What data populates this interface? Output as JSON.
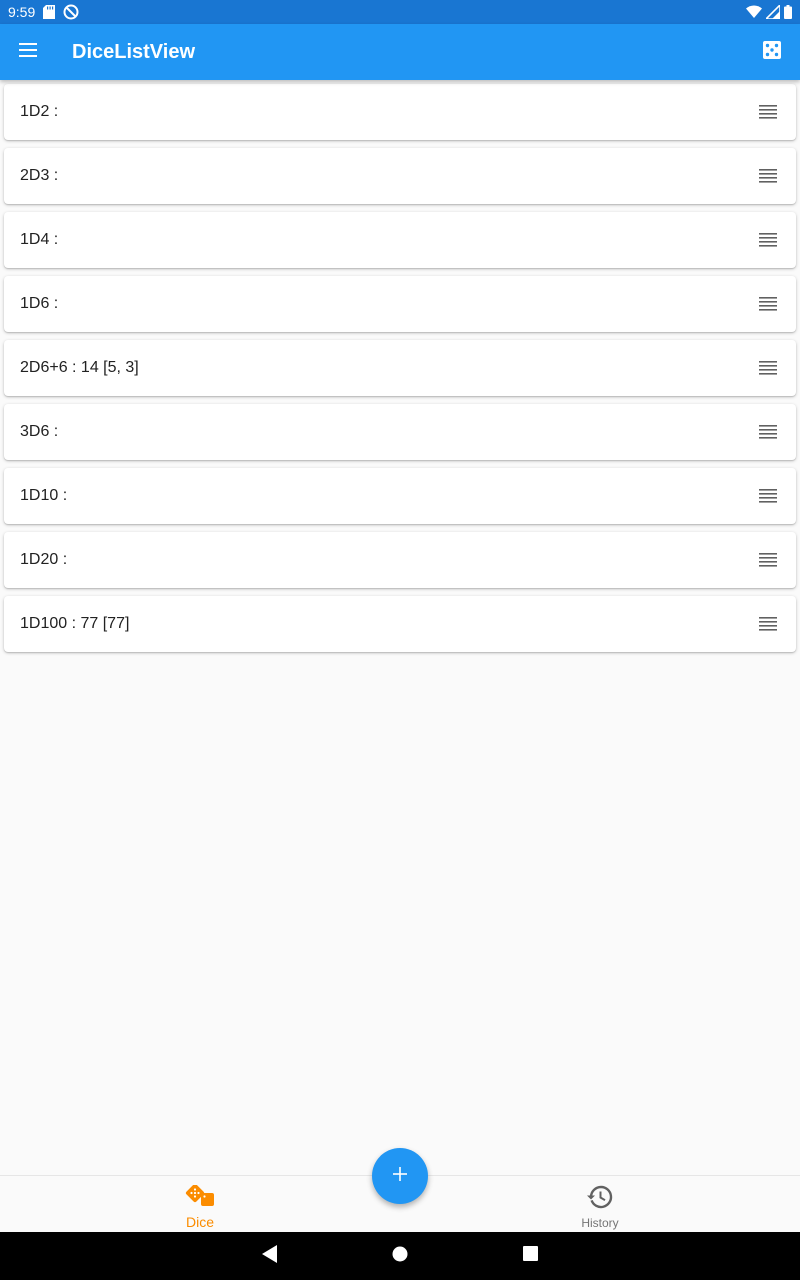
{
  "status_bar": {
    "time": "9:59"
  },
  "app_bar": {
    "title": "DiceListView",
    "menu_icon": "hamburger-menu-icon",
    "action_icon": "dice-icon"
  },
  "dice_list": [
    {
      "label": "1D2 :"
    },
    {
      "label": "2D3 :"
    },
    {
      "label": "1D4 :"
    },
    {
      "label": "1D6 :"
    },
    {
      "label": "2D6+6 : 14 [5, 3]"
    },
    {
      "label": "3D6 :"
    },
    {
      "label": "1D10 :"
    },
    {
      "label": "1D20 :"
    },
    {
      "label": "1D100 : 77 [77]"
    }
  ],
  "fab": {
    "icon": "plus-icon"
  },
  "bottom_nav": {
    "items": [
      {
        "label": "Dice",
        "icon": "dice-icon",
        "active": true
      },
      {
        "label": "History",
        "icon": "history-icon",
        "active": false
      }
    ]
  },
  "colors": {
    "primary": "#2196f3",
    "status_bar": "#1976d2",
    "accent_active": "#fb8c00",
    "background": "#fafafa"
  }
}
